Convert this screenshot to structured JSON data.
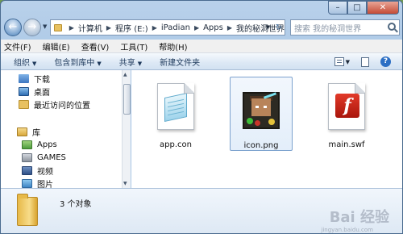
{
  "address": {
    "crumbs": [
      "计算机",
      "程序 (E:)",
      "iPadian",
      "Apps",
      "我的秘洞世界"
    ]
  },
  "search": {
    "placeholder": "搜索 我的秘洞世界"
  },
  "menubar": {
    "items": [
      "文件(F)",
      "编辑(E)",
      "查看(V)",
      "工具(T)",
      "帮助(H)"
    ]
  },
  "commandbar": {
    "organize": "组织",
    "include_library": "包含到库中",
    "share": "共享",
    "new_folder": "新建文件夹"
  },
  "navpane": {
    "favorites": [
      "下载",
      "桌面",
      "最近访问的位置"
    ],
    "library_label": "库",
    "libraries": [
      "Apps",
      "GAMES",
      "视频",
      "图片"
    ]
  },
  "files": [
    {
      "name": "app.con",
      "type": "text-file-icon"
    },
    {
      "name": "icon.png",
      "type": "image-thumbnail"
    },
    {
      "name": "main.swf",
      "type": "flash-file-icon"
    }
  ],
  "details": {
    "count_text": "3 个对象"
  },
  "watermark": {
    "text": "Bai 经验",
    "sub": "jingyan.baidu.com"
  }
}
